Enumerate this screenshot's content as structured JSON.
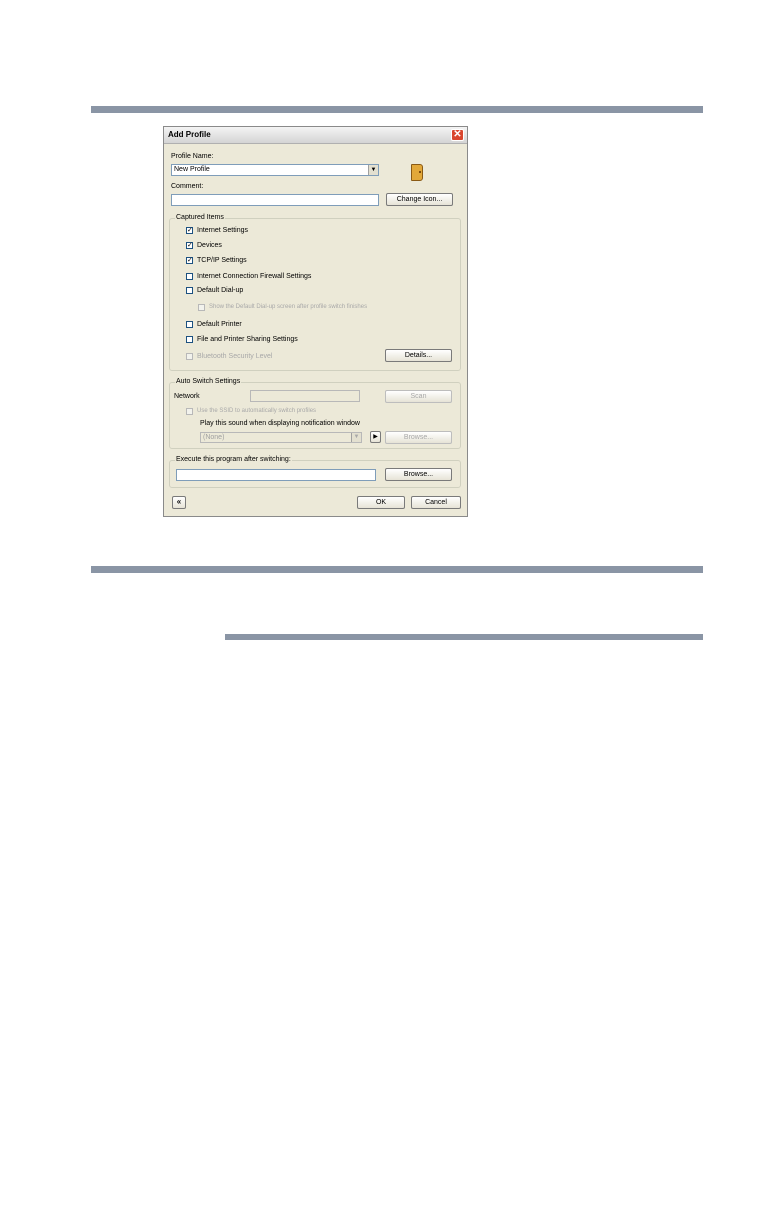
{
  "dialog": {
    "title": "Add Profile",
    "close_label": "✕",
    "profile_name_label": "Profile Name:",
    "profile_name_value": "New Profile",
    "profile_icon": "door-icon",
    "comment_label": "Comment:",
    "comment_value": "",
    "change_icon_button": "Change Icon...",
    "captured": {
      "label": "Captured Items",
      "items": [
        {
          "label": "Internet Settings",
          "checked": true,
          "enabled": true
        },
        {
          "label": "Devices",
          "checked": true,
          "enabled": true
        },
        {
          "label": "TCP/IP Settings",
          "checked": true,
          "enabled": true
        },
        {
          "label": "Internet Connection Firewall Settings",
          "checked": false,
          "enabled": true
        },
        {
          "label": "Default Dial-up",
          "checked": false,
          "enabled": true
        },
        {
          "label": "Show the Default Dial-up screen after profile switch finishes",
          "checked": false,
          "enabled": false
        },
        {
          "label": "Default Printer",
          "checked": false,
          "enabled": true
        },
        {
          "label": "File and Printer Sharing Settings",
          "checked": false,
          "enabled": true
        },
        {
          "label": "Bluetooth Security Level",
          "checked": false,
          "enabled": false
        }
      ],
      "details_button": "Details..."
    },
    "auto_switch": {
      "label": "Auto Switch Settings",
      "network_label": "Network",
      "network_value": "",
      "scan_button": "Scan",
      "ssid_checkbox": "Use the SSID to automatically switch profiles",
      "sound_label": "Play this sound when displaying notification window",
      "sound_value": "(None)",
      "play_button": "▶",
      "browse_button": "Browse..."
    },
    "execute": {
      "label": "Execute this program after switching:",
      "value": "",
      "browse_button": "Browse..."
    },
    "collapse_button": "«",
    "ok_button": "OK",
    "cancel_button": "Cancel"
  }
}
